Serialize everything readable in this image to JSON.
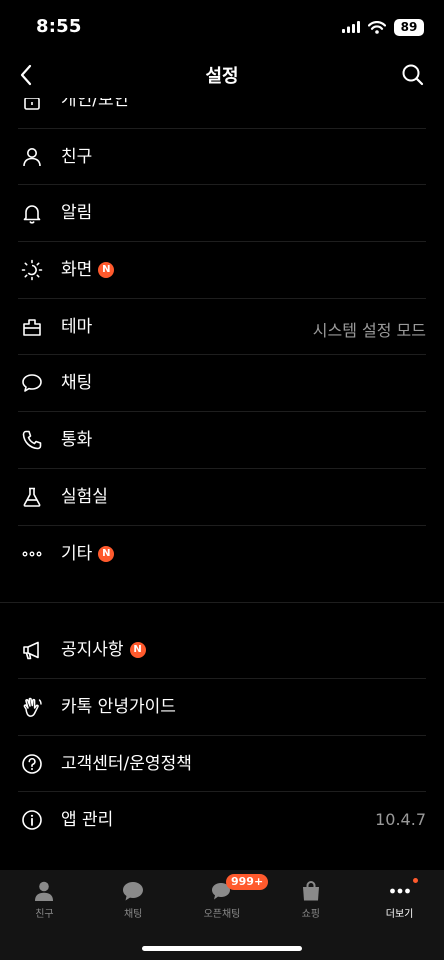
{
  "status": {
    "time": "8:55",
    "battery": "89"
  },
  "header": {
    "title": "설정",
    "back_icon": "chevron-left-icon",
    "search_icon": "search-icon"
  },
  "list_top": [
    {
      "label": "개인/보안",
      "icon": "lock-icon",
      "badge": "",
      "value": ""
    },
    {
      "label": "친구",
      "icon": "person-icon",
      "badge": "",
      "value": ""
    },
    {
      "label": "알림",
      "icon": "bell-icon",
      "badge": "",
      "value": ""
    },
    {
      "label": "화면",
      "icon": "sun-icon",
      "badge": "N",
      "value": ""
    },
    {
      "label": "테마",
      "icon": "theme-icon",
      "badge": "",
      "value": "시스템 설정 모드"
    },
    {
      "label": "채팅",
      "icon": "chat-bubble-icon",
      "badge": "",
      "value": ""
    },
    {
      "label": "통화",
      "icon": "phone-icon",
      "badge": "",
      "value": ""
    },
    {
      "label": "실험실",
      "icon": "flask-icon",
      "badge": "",
      "value": ""
    },
    {
      "label": "기타",
      "icon": "more-dots-icon",
      "badge": "N",
      "value": ""
    }
  ],
  "list_bottom": [
    {
      "label": "공지사항",
      "icon": "megaphone-icon",
      "badge": "N",
      "value": ""
    },
    {
      "label": "카톡 안녕가이드",
      "icon": "hand-wave-icon",
      "badge": "",
      "value": ""
    },
    {
      "label": "고객센터/운영정책",
      "icon": "help-circle-icon",
      "badge": "",
      "value": ""
    },
    {
      "label": "앱 관리",
      "icon": "info-circle-icon",
      "badge": "",
      "value": "10.4.7"
    }
  ],
  "tabs": [
    {
      "label": "친구",
      "icon": "friends-tab-icon",
      "badge": "",
      "dot": false,
      "active": false
    },
    {
      "label": "채팅",
      "icon": "chat-tab-icon",
      "badge": "",
      "dot": false,
      "active": false
    },
    {
      "label": "오픈채팅",
      "icon": "openchat-tab-icon",
      "badge": "999+",
      "dot": false,
      "active": false
    },
    {
      "label": "쇼핑",
      "icon": "shopping-bag-icon",
      "badge": "",
      "dot": false,
      "active": false
    },
    {
      "label": "더보기",
      "icon": "more-tab-icon",
      "badge": "",
      "dot": true,
      "active": true
    }
  ],
  "colors": {
    "background": "#000000",
    "accent": "#ff5a2d",
    "tabbar": "#141414"
  }
}
